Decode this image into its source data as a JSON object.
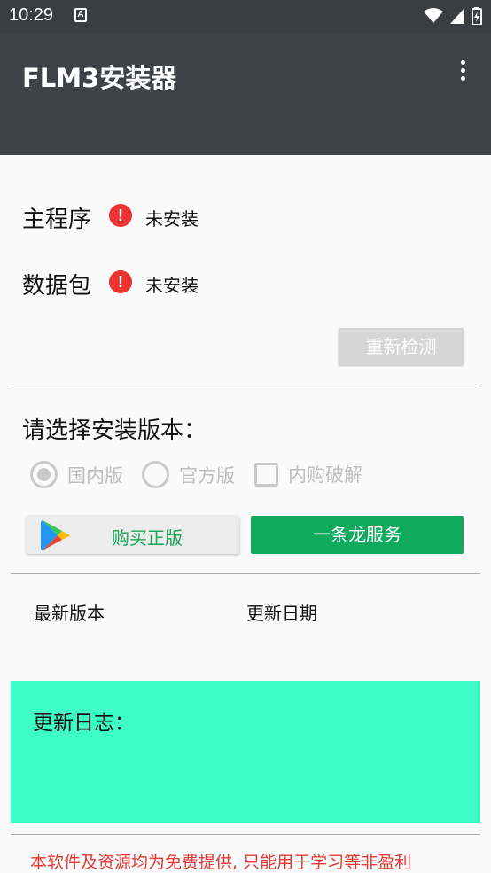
{
  "status_bar": {
    "time": "10:29",
    "notification_glyph": "A",
    "icons": [
      "wifi-icon",
      "signal-icon",
      "battery-icon"
    ]
  },
  "app_bar": {
    "title": "FLM3安装器",
    "menu_icon": "more-vert-icon"
  },
  "install_status": {
    "main_program": {
      "label": "主程序",
      "status": "未安装",
      "icon": "error-icon"
    },
    "data_package": {
      "label": "数据包",
      "status": "未安装",
      "icon": "error-icon"
    },
    "recheck_label": "重新检测"
  },
  "version_select": {
    "title": "请选择安装版本：",
    "options": [
      {
        "label": "国内版",
        "type": "radio",
        "checked": true
      },
      {
        "label": "官方版",
        "type": "radio",
        "checked": false
      },
      {
        "label": "内购破解",
        "type": "checkbox",
        "checked": false
      }
    ]
  },
  "actions": {
    "buy_label": "购买正版",
    "buy_icon": "google-play-icon",
    "service_label": "一条龙服务"
  },
  "version_info": {
    "latest_version_label": "最新版本",
    "update_date_label": "更新日期"
  },
  "changelog": {
    "title": "更新日志："
  },
  "footer": {
    "disclaimer": "本软件及资源均为免费提供, 只能用于学习等非盈利"
  },
  "colors": {
    "app_bar": "#3f4347",
    "status_bar": "#3a3d42",
    "error": "#ee3333",
    "service_button": "#0faa5b",
    "buy_text": "#1aa55a",
    "changelog_bg": "#3dfcc6",
    "disclaimer_text": "#e53935"
  }
}
